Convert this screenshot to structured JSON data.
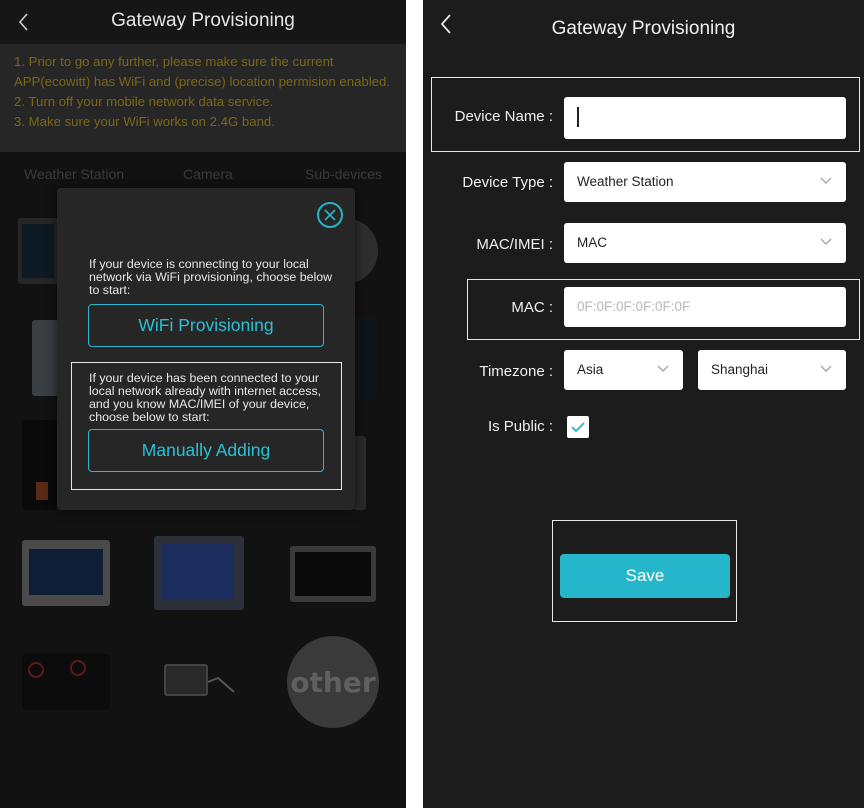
{
  "left": {
    "header": {
      "title": "Gateway Provisioning"
    },
    "tips": [
      "1. Prior to go any further, please make sure the current",
      "APP(ecowitt) has WiFi and (precise) location permision enabled.",
      "2. Turn off your mobile network data service.",
      "3. Make sure your WiFi works on 2.4G band."
    ],
    "tabs": [
      "Weather Station",
      "Camera",
      "Sub-devices"
    ],
    "other_label": "other",
    "modal": {
      "wifi_text": "If your device is connecting to your local network via WiFi provisioning, choose below to start:",
      "wifi_button": "WiFi Provisioning",
      "manual_text": "If your device has been connected to your local network already with internet access, and you know MAC/IMEI of your device, choose below to start:",
      "manual_button": "Manually Adding"
    }
  },
  "right": {
    "header": {
      "title": "Gateway Provisioning"
    },
    "form": {
      "device_name": {
        "label": "Device Name :",
        "value": ""
      },
      "device_type": {
        "label": "Device Type :",
        "value": "Weather Station"
      },
      "mac_imei": {
        "label": "MAC/IMEI :",
        "value": "MAC"
      },
      "mac": {
        "label": "MAC :",
        "placeholder": "0F:0F:0F:0F:0F:0F"
      },
      "timezone": {
        "label": "Timezone :",
        "region": "Asia",
        "city": "Shanghai"
      },
      "is_public": {
        "label": "Is Public :",
        "checked": true
      }
    },
    "save_label": "Save"
  },
  "colors": {
    "accent": "#25b6cb",
    "tip_text": "#7a6716",
    "background": "#1c1c1c"
  }
}
